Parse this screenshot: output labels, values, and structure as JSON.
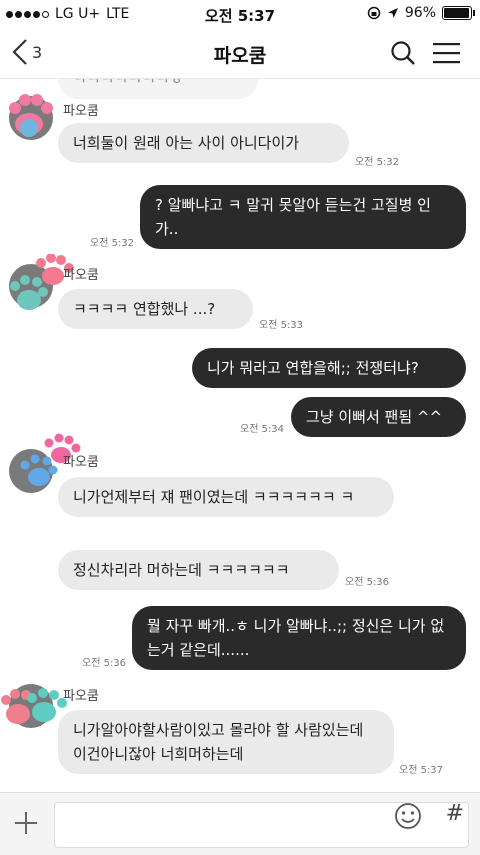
{
  "status": {
    "carrier": "LG U+",
    "network": "LTE",
    "time": "오전 5:37",
    "battery": "96%",
    "battery_level": 0.96
  },
  "header": {
    "title": "파오쿰",
    "back_count": "3"
  },
  "colors": {
    "in_bubble": "#eaeaea",
    "out_bubble": "#2a2a2a"
  },
  "messages": [
    {
      "sender": "파오쿰",
      "text": "너희둘이 원래 아는 사이 아니다이가",
      "time": "오전 5:32"
    },
    {
      "text": "? 알빠냐고 ㅋ 말귀 못알아 듣는건 고질병 인가..",
      "time": "오전 5:32"
    },
    {
      "sender": "파오쿰",
      "text": "ㅋㅋㅋㅋ 연합했나 ...?",
      "time": "오전 5:33"
    },
    {
      "text": "니가 뭐라고 연합을해;; 전쟁터냐?"
    },
    {
      "text": "그냥 이뻐서 팬됨 ^^",
      "time": "오전 5:34"
    },
    {
      "sender": "파오쿰",
      "text": "니가언제부터 쟤 팬이였는데 ㅋㅋㅋㅋㅋㅋ ㅋ"
    },
    {
      "text": "정신차리라 머하는데 ㅋㅋㅋㅋㅋㅋ",
      "time": "오전 5:36"
    },
    {
      "text": "뭘 자꾸 빠개..ㅎ 니가 알빠냐..;; 정신은 니가 없는거 같은데......",
      "time": "오전 5:36"
    },
    {
      "sender": "파오쿰",
      "text": "니가알아야할사람이있고 몰라야 할 사람있는데 이건아니잖아 너희머하는데",
      "time": "오전 5:37"
    }
  ],
  "faded_top_text": "ㅋㅋㅋㅋㅋㅋㅋㅎ",
  "input": {
    "placeholder": ""
  }
}
